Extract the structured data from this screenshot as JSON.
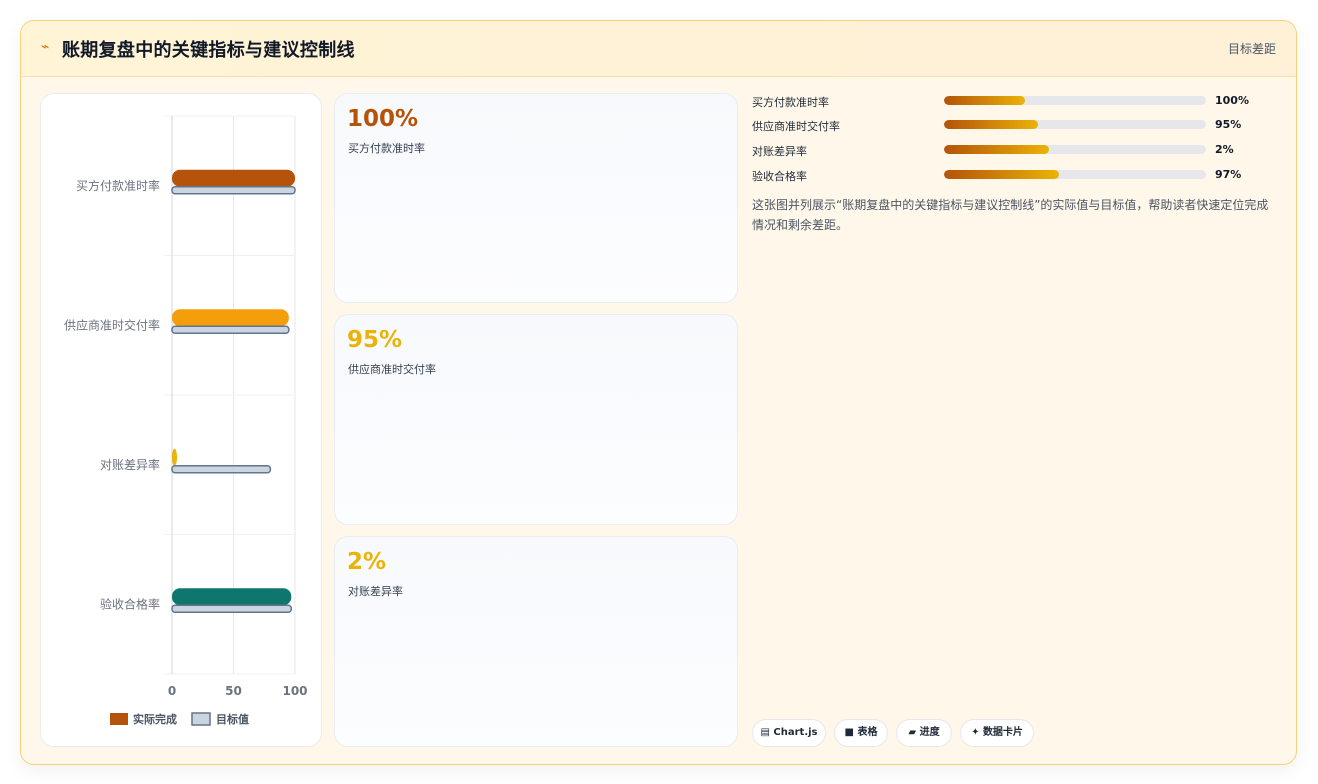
{
  "header": {
    "icon": "chart-trend-icon",
    "title": "账期复盘中的关键指标与建议控制线",
    "right_link": "目标差距"
  },
  "colors": {
    "accent": "#b45309",
    "series": [
      "#b45309",
      "#f59e0b",
      "#eab308",
      "#0f766e"
    ],
    "target": "#cbd5e1"
  },
  "chart_data": {
    "type": "bar",
    "orientation": "horizontal",
    "categories": [
      "买方付款准时率",
      "供应商准时交付率",
      "对账差异率",
      "验收合格率"
    ],
    "series": [
      {
        "name": "实际完成",
        "values": [
          100,
          95,
          2,
          97
        ]
      },
      {
        "name": "目标值",
        "values": [
          100,
          95,
          80,
          97
        ]
      }
    ],
    "xlim": [
      0,
      100
    ],
    "xticks": [
      0,
      50,
      100
    ],
    "grid": true,
    "legend": "bottom"
  },
  "stats": [
    {
      "value": "100%",
      "label": "买方付款准时率",
      "color": "#b45309"
    },
    {
      "value": "95%",
      "label": "供应商准时交付率",
      "color": "#eab308"
    },
    {
      "value": "2%",
      "label": "对账差异率",
      "color": "#eab308"
    }
  ],
  "progress": [
    {
      "label": "买方付款准时率",
      "value": "100%",
      "fill": 0.31
    },
    {
      "label": "供应商准时交付率",
      "value": "95%",
      "fill": 0.36
    },
    {
      "label": "对账差异率",
      "value": "2%",
      "fill": 0.4
    },
    {
      "label": "验收合格率",
      "value": "97%",
      "fill": 0.44
    }
  ],
  "description": "这张图并列展示“账期复盘中的关键指标与建议控制线”的实际值与目标值，帮助读者快速定位完成情况和剩余差距。",
  "tags": [
    {
      "icon": "table-icon",
      "label": "Chart.js",
      "glyph": "▤"
    },
    {
      "icon": "grid-icon",
      "label": "表格",
      "glyph": "■"
    },
    {
      "icon": "progress-icon",
      "label": "进度",
      "glyph": "▰"
    },
    {
      "icon": "card-icon",
      "label": "数据卡片",
      "glyph": "✦"
    }
  ]
}
